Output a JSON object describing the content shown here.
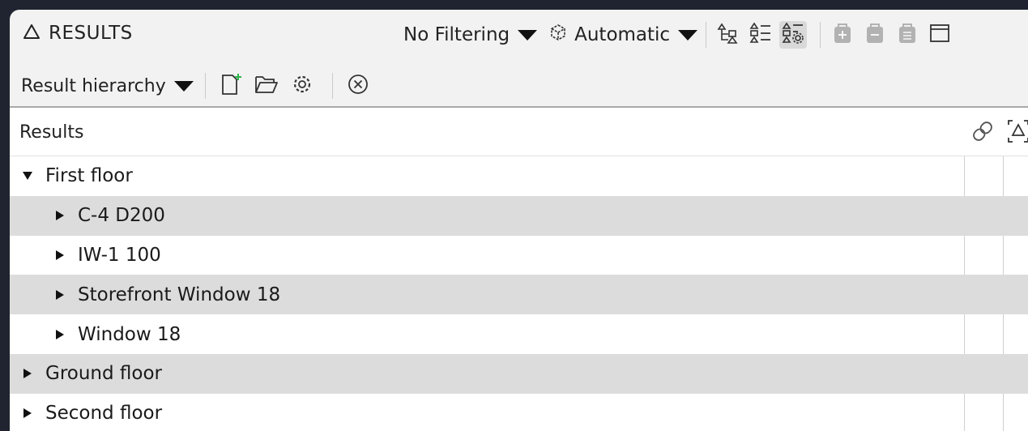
{
  "header": {
    "title": "RESULTS",
    "filter_dropdown": "No Filtering",
    "mode_dropdown": "Automatic"
  },
  "toolbar2": {
    "hierarchy_dropdown": "Result hierarchy"
  },
  "table": {
    "column_header": "Results",
    "rows": [
      {
        "label": "First floor",
        "level": 0,
        "expanded": true
      },
      {
        "label": "C-4 D200",
        "level": 1,
        "expanded": false
      },
      {
        "label": "IW-1 100",
        "level": 1,
        "expanded": false
      },
      {
        "label": "Storefront Window 18",
        "level": 1,
        "expanded": false
      },
      {
        "label": "Window 18",
        "level": 1,
        "expanded": false
      },
      {
        "label": "Ground floor",
        "level": 0,
        "expanded": false
      },
      {
        "label": "Second floor",
        "level": 0,
        "expanded": false
      }
    ]
  },
  "colors": {
    "panel_bg": "#f2f2f2",
    "alt_row": "#dcdcdc",
    "accent_green": "#2db34a"
  }
}
